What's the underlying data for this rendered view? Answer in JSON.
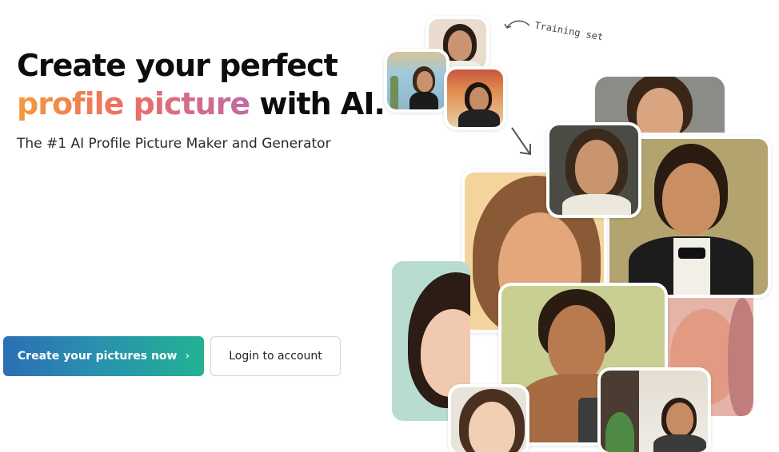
{
  "hero": {
    "title_line1": "Create your perfect",
    "title_highlight": "profile picture",
    "title_rest": " with AI.",
    "subtitle": "The #1 AI Profile Picture Maker and Generator"
  },
  "cta": {
    "primary_label": "Create your pictures now",
    "primary_chevron": "›",
    "secondary_label": "Login to account"
  },
  "annotation": {
    "training_label": "Training set"
  },
  "colors": {
    "gradient_text": [
      "#f59a3c",
      "#ee6f62",
      "#c06aa6"
    ],
    "primary_button": [
      "#2b6fb4",
      "#22b292"
    ]
  },
  "icons": {
    "curved_arrow": "curved-arrow-icon",
    "down_arrow": "arrow-down-right-icon",
    "chevron": "chevron-right-icon"
  }
}
